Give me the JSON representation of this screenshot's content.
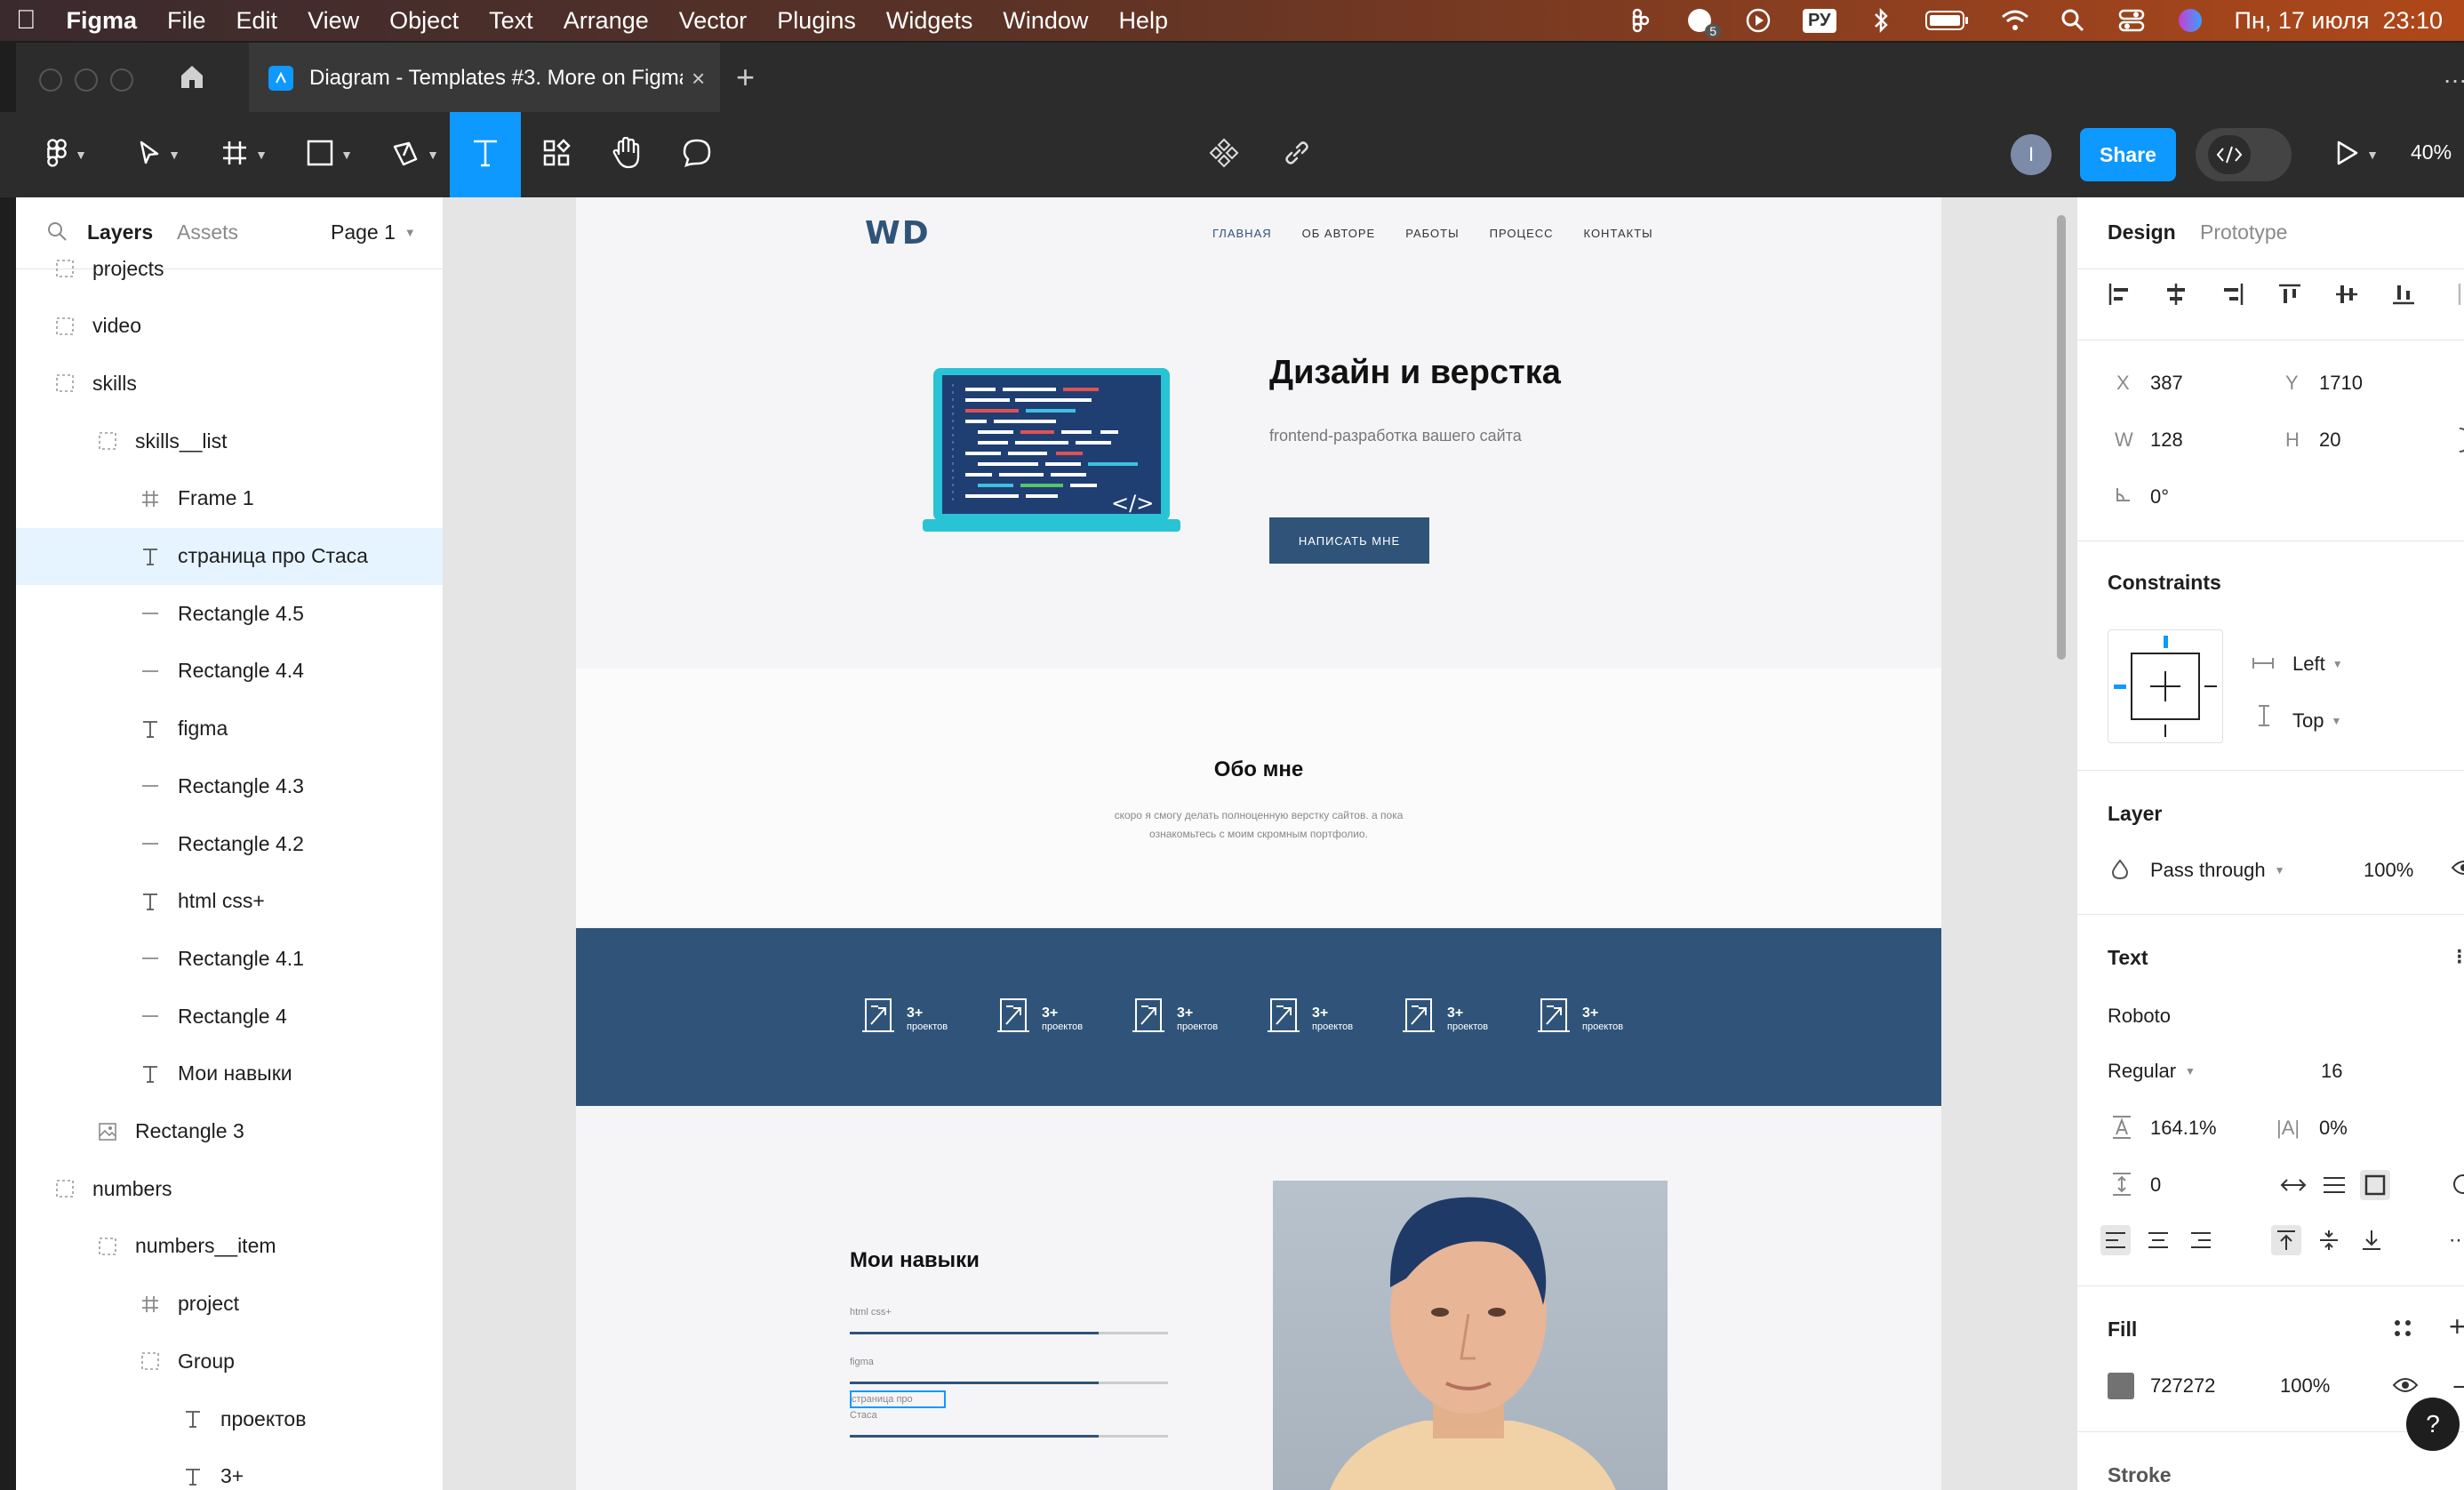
{
  "menubar": {
    "app": "Figma",
    "items": [
      "File",
      "Edit",
      "View",
      "Object",
      "Text",
      "Arrange",
      "Vector",
      "Plugins",
      "Widgets",
      "Window",
      "Help"
    ],
    "lang": "РУ",
    "badge": "5",
    "datetime": "Пн, 17 июля  23:10"
  },
  "tabbar": {
    "tab_title": "Diagram - Templates #3. More on Figma"
  },
  "toolbar": {
    "avatar": "I",
    "share": "Share",
    "zoom": "40%"
  },
  "left_panel": {
    "tabs": [
      "Layers",
      "Assets"
    ],
    "page": "Page 1",
    "layers": [
      {
        "icon": "frame-dashed",
        "label": "projects",
        "indent": 0
      },
      {
        "icon": "frame-dashed",
        "label": "video",
        "indent": 0
      },
      {
        "icon": "frame-dashed",
        "label": "skills",
        "indent": 0
      },
      {
        "icon": "frame-dashed",
        "label": "skills__list",
        "indent": 1
      },
      {
        "icon": "hash",
        "label": "Frame 1",
        "indent": 2
      },
      {
        "icon": "text",
        "label": "страница про Стаса",
        "indent": 2,
        "selected": true
      },
      {
        "icon": "line",
        "label": "Rectangle 4.5",
        "indent": 2
      },
      {
        "icon": "line",
        "label": "Rectangle 4.4",
        "indent": 2
      },
      {
        "icon": "text",
        "label": "figma",
        "indent": 2
      },
      {
        "icon": "line",
        "label": "Rectangle 4.3",
        "indent": 2
      },
      {
        "icon": "line",
        "label": "Rectangle 4.2",
        "indent": 2
      },
      {
        "icon": "text",
        "label": "html css+",
        "indent": 2
      },
      {
        "icon": "line",
        "label": "Rectangle 4.1",
        "indent": 2
      },
      {
        "icon": "line",
        "label": "Rectangle 4",
        "indent": 2
      },
      {
        "icon": "text",
        "label": "Мои навыки",
        "indent": 2
      },
      {
        "icon": "image",
        "label": "Rectangle 3",
        "indent": 1
      },
      {
        "icon": "frame-dashed",
        "label": "numbers",
        "indent": 0
      },
      {
        "icon": "frame-dashed",
        "label": "numbers__item",
        "indent": 1
      },
      {
        "icon": "hash",
        "label": "project",
        "indent": 2
      },
      {
        "icon": "frame-dashed",
        "label": "Group",
        "indent": 2
      },
      {
        "icon": "text",
        "label": "проектов",
        "indent": 3
      },
      {
        "icon": "text",
        "label": "3+",
        "indent": 3
      }
    ]
  },
  "site": {
    "logo": "WD",
    "nav": [
      "ГЛАВНАЯ",
      "ОБ АВТОРЕ",
      "РАБОТЫ",
      "ПРОЦЕСС",
      "КОНТАКТЫ"
    ],
    "hero_title": "Дизайн и верстка",
    "hero_subtitle": "frontend-разработка вашего сайта",
    "hero_button": "НАПИСАТЬ МНЕ",
    "code_tag": "</>",
    "about_title": "Обо мне",
    "about_text_1": "скоро я смогу делать полноценную верстку сайтов. а пока",
    "about_text_2": "ознакомьтесь с моим скромным портфолио.",
    "stats": [
      {
        "value": "3+",
        "label": "проектов"
      },
      {
        "value": "3+",
        "label": "проектов"
      },
      {
        "value": "3+",
        "label": "проектов"
      },
      {
        "value": "3+",
        "label": "проектов"
      },
      {
        "value": "3+",
        "label": "проектов"
      },
      {
        "value": "3+",
        "label": "проектов"
      }
    ],
    "skills_title": "Мои навыки",
    "skills": [
      "html css+",
      "figma"
    ],
    "editing_text": "страница про",
    "editing_text_2": "Стаса"
  },
  "right_panel": {
    "tabs": [
      "Design",
      "Prototype"
    ],
    "x_label": "X",
    "x": "387",
    "y_label": "Y",
    "y": "1710",
    "w_label": "W",
    "w": "128",
    "h_label": "H",
    "h": "20",
    "rotation": "0°",
    "constraints_title": "Constraints",
    "constraint_h": "Left",
    "constraint_v": "Top",
    "layer_title": "Layer",
    "blend": "Pass through",
    "opacity": "100%",
    "text_title": "Text",
    "font": "Roboto",
    "weight": "Regular",
    "size": "16",
    "line_height": "164.1%",
    "letter_spacing": "0%",
    "paragraph": "0",
    "fill_title": "Fill",
    "fill_hex": "727272",
    "fill_opacity": "100%",
    "stroke_title": "Stroke",
    "help": "?"
  },
  "colors": {
    "accent": "#0d99ff",
    "site_blue": "#305479",
    "fill_swatch": "#727272"
  }
}
